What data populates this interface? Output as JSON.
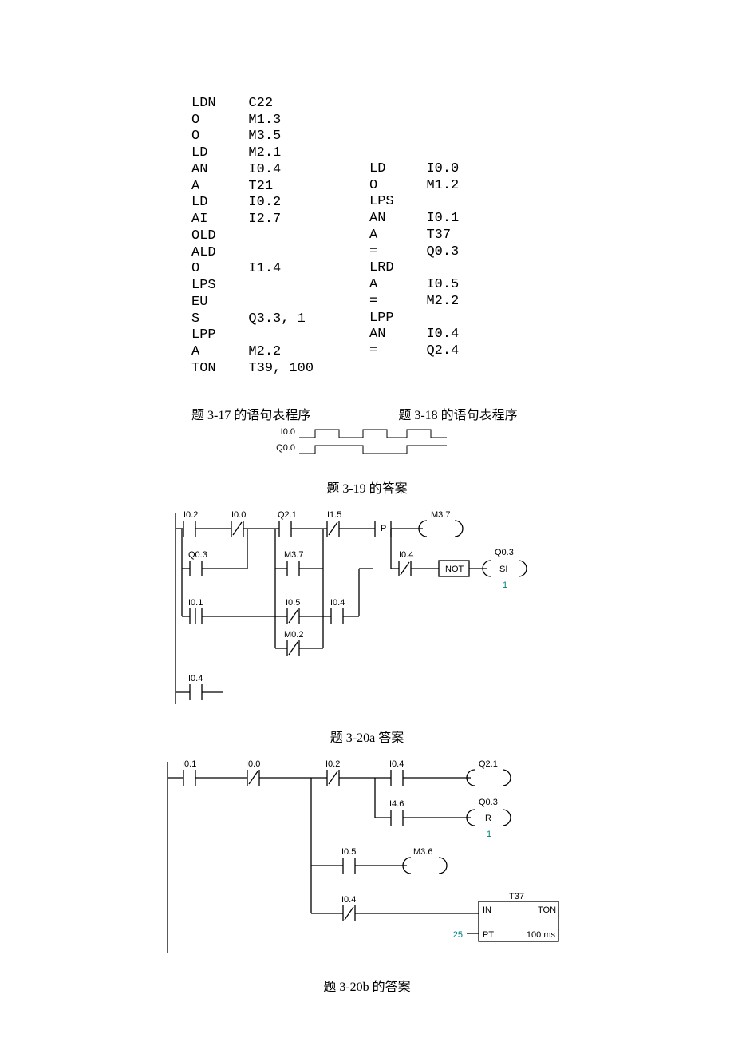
{
  "program317": {
    "lines": [
      [
        "LDN",
        "C22"
      ],
      [
        "O",
        "M1.3"
      ],
      [
        "O",
        "M3.5"
      ],
      [
        "LD",
        "M2.1"
      ],
      [
        "AN",
        "I0.4"
      ],
      [
        "A",
        "T21"
      ],
      [
        "LD",
        "I0.2"
      ],
      [
        "AI",
        "I2.7"
      ],
      [
        "OLD",
        ""
      ],
      [
        "ALD",
        ""
      ],
      [
        "O",
        "I1.4"
      ],
      [
        "LPS",
        ""
      ],
      [
        "EU",
        ""
      ],
      [
        "S",
        "Q3.3, 1"
      ],
      [
        "LPP",
        ""
      ],
      [
        "A",
        "M2.2"
      ],
      [
        "TON",
        "T39, 100"
      ]
    ]
  },
  "program318": {
    "lines": [
      [
        "LD",
        "I0.0"
      ],
      [
        "O",
        "M1.2"
      ],
      [
        "LPS",
        ""
      ],
      [
        "AN",
        "I0.1"
      ],
      [
        "A",
        "T37"
      ],
      [
        "=",
        "Q0.3"
      ],
      [
        "LRD",
        ""
      ],
      [
        "A",
        "I0.5"
      ],
      [
        "=",
        "M2.2"
      ],
      [
        "LPP",
        ""
      ],
      [
        "AN",
        "I0.4"
      ],
      [
        "=",
        "Q2.4"
      ]
    ]
  },
  "captions": {
    "c317": "题 3-17 的语句表程序",
    "c318": "题 3-18 的语句表程序",
    "c319": "题 3-19 的答案",
    "c320a": "题 3-20a 答案",
    "c320b": "题 3-20b 的答案"
  },
  "fig19": {
    "left0": "I0.0",
    "left1": "Q0.0"
  },
  "fig20a": {
    "i02": "I0.2",
    "i00": "I0.0",
    "q21": "Q2.1",
    "i15": "I1.5",
    "m37": "M3.7",
    "q03": "Q0.3",
    "m37b": "M3.7",
    "i04": "I0.4",
    "q03b": "Q0.3",
    "si": "SI",
    "one": "1",
    "i01": "I0.1",
    "i05": "I0.5",
    "i04b": "I0.4",
    "m02": "M0.2",
    "not": "NOT",
    "p": "P",
    "i04c": "I0.4"
  },
  "fig20b": {
    "i01": "I0.1",
    "i00": "I0.0",
    "i02": "I0.2",
    "i04": "I0.4",
    "q21": "Q2.1",
    "i46": "I4.6",
    "q03": "Q0.3",
    "r": "R",
    "one": "1",
    "i05": "I0.5",
    "m36": "M3.6",
    "i04b": "I0.4",
    "t37": "T37",
    "in": "IN",
    "ton": "TON",
    "pt": "PT",
    "pt25": "25",
    "ms": "100 ms"
  }
}
